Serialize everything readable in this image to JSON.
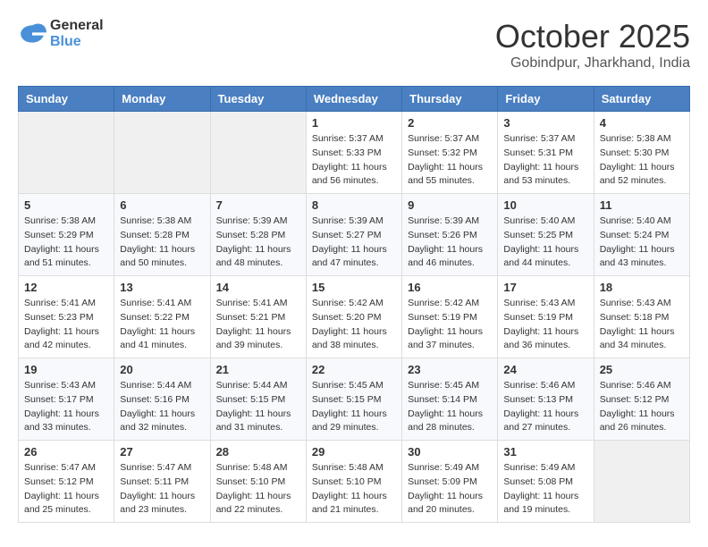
{
  "logo": {
    "general": "General",
    "blue": "Blue"
  },
  "title": "October 2025",
  "location": "Gobindpur, Jharkhand, India",
  "days_of_week": [
    "Sunday",
    "Monday",
    "Tuesday",
    "Wednesday",
    "Thursday",
    "Friday",
    "Saturday"
  ],
  "weeks": [
    [
      {
        "day": "",
        "info": ""
      },
      {
        "day": "",
        "info": ""
      },
      {
        "day": "",
        "info": ""
      },
      {
        "day": "1",
        "info": "Sunrise: 5:37 AM\nSunset: 5:33 PM\nDaylight: 11 hours and 56 minutes."
      },
      {
        "day": "2",
        "info": "Sunrise: 5:37 AM\nSunset: 5:32 PM\nDaylight: 11 hours and 55 minutes."
      },
      {
        "day": "3",
        "info": "Sunrise: 5:37 AM\nSunset: 5:31 PM\nDaylight: 11 hours and 53 minutes."
      },
      {
        "day": "4",
        "info": "Sunrise: 5:38 AM\nSunset: 5:30 PM\nDaylight: 11 hours and 52 minutes."
      }
    ],
    [
      {
        "day": "5",
        "info": "Sunrise: 5:38 AM\nSunset: 5:29 PM\nDaylight: 11 hours and 51 minutes."
      },
      {
        "day": "6",
        "info": "Sunrise: 5:38 AM\nSunset: 5:28 PM\nDaylight: 11 hours and 50 minutes."
      },
      {
        "day": "7",
        "info": "Sunrise: 5:39 AM\nSunset: 5:28 PM\nDaylight: 11 hours and 48 minutes."
      },
      {
        "day": "8",
        "info": "Sunrise: 5:39 AM\nSunset: 5:27 PM\nDaylight: 11 hours and 47 minutes."
      },
      {
        "day": "9",
        "info": "Sunrise: 5:39 AM\nSunset: 5:26 PM\nDaylight: 11 hours and 46 minutes."
      },
      {
        "day": "10",
        "info": "Sunrise: 5:40 AM\nSunset: 5:25 PM\nDaylight: 11 hours and 44 minutes."
      },
      {
        "day": "11",
        "info": "Sunrise: 5:40 AM\nSunset: 5:24 PM\nDaylight: 11 hours and 43 minutes."
      }
    ],
    [
      {
        "day": "12",
        "info": "Sunrise: 5:41 AM\nSunset: 5:23 PM\nDaylight: 11 hours and 42 minutes."
      },
      {
        "day": "13",
        "info": "Sunrise: 5:41 AM\nSunset: 5:22 PM\nDaylight: 11 hours and 41 minutes."
      },
      {
        "day": "14",
        "info": "Sunrise: 5:41 AM\nSunset: 5:21 PM\nDaylight: 11 hours and 39 minutes."
      },
      {
        "day": "15",
        "info": "Sunrise: 5:42 AM\nSunset: 5:20 PM\nDaylight: 11 hours and 38 minutes."
      },
      {
        "day": "16",
        "info": "Sunrise: 5:42 AM\nSunset: 5:19 PM\nDaylight: 11 hours and 37 minutes."
      },
      {
        "day": "17",
        "info": "Sunrise: 5:43 AM\nSunset: 5:19 PM\nDaylight: 11 hours and 36 minutes."
      },
      {
        "day": "18",
        "info": "Sunrise: 5:43 AM\nSunset: 5:18 PM\nDaylight: 11 hours and 34 minutes."
      }
    ],
    [
      {
        "day": "19",
        "info": "Sunrise: 5:43 AM\nSunset: 5:17 PM\nDaylight: 11 hours and 33 minutes."
      },
      {
        "day": "20",
        "info": "Sunrise: 5:44 AM\nSunset: 5:16 PM\nDaylight: 11 hours and 32 minutes."
      },
      {
        "day": "21",
        "info": "Sunrise: 5:44 AM\nSunset: 5:15 PM\nDaylight: 11 hours and 31 minutes."
      },
      {
        "day": "22",
        "info": "Sunrise: 5:45 AM\nSunset: 5:15 PM\nDaylight: 11 hours and 29 minutes."
      },
      {
        "day": "23",
        "info": "Sunrise: 5:45 AM\nSunset: 5:14 PM\nDaylight: 11 hours and 28 minutes."
      },
      {
        "day": "24",
        "info": "Sunrise: 5:46 AM\nSunset: 5:13 PM\nDaylight: 11 hours and 27 minutes."
      },
      {
        "day": "25",
        "info": "Sunrise: 5:46 AM\nSunset: 5:12 PM\nDaylight: 11 hours and 26 minutes."
      }
    ],
    [
      {
        "day": "26",
        "info": "Sunrise: 5:47 AM\nSunset: 5:12 PM\nDaylight: 11 hours and 25 minutes."
      },
      {
        "day": "27",
        "info": "Sunrise: 5:47 AM\nSunset: 5:11 PM\nDaylight: 11 hours and 23 minutes."
      },
      {
        "day": "28",
        "info": "Sunrise: 5:48 AM\nSunset: 5:10 PM\nDaylight: 11 hours and 22 minutes."
      },
      {
        "day": "29",
        "info": "Sunrise: 5:48 AM\nSunset: 5:10 PM\nDaylight: 11 hours and 21 minutes."
      },
      {
        "day": "30",
        "info": "Sunrise: 5:49 AM\nSunset: 5:09 PM\nDaylight: 11 hours and 20 minutes."
      },
      {
        "day": "31",
        "info": "Sunrise: 5:49 AM\nSunset: 5:08 PM\nDaylight: 11 hours and 19 minutes."
      },
      {
        "day": "",
        "info": ""
      }
    ]
  ]
}
